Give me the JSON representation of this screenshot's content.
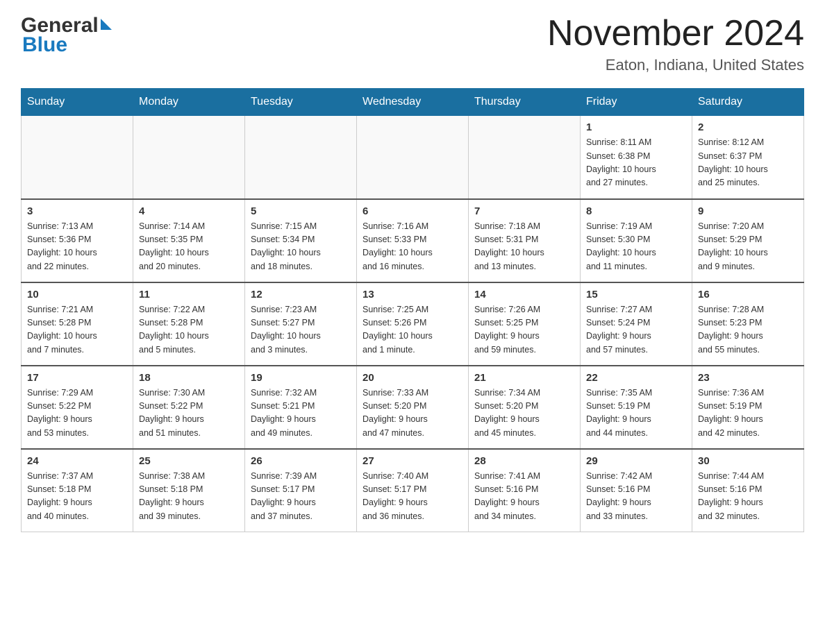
{
  "header": {
    "logo_text1": "General",
    "logo_text2": "Blue",
    "calendar_title": "November 2024",
    "calendar_subtitle": "Eaton, Indiana, United States"
  },
  "weekdays": [
    "Sunday",
    "Monday",
    "Tuesday",
    "Wednesday",
    "Thursday",
    "Friday",
    "Saturday"
  ],
  "weeks": [
    [
      {
        "day": "",
        "info": ""
      },
      {
        "day": "",
        "info": ""
      },
      {
        "day": "",
        "info": ""
      },
      {
        "day": "",
        "info": ""
      },
      {
        "day": "",
        "info": ""
      },
      {
        "day": "1",
        "info": "Sunrise: 8:11 AM\nSunset: 6:38 PM\nDaylight: 10 hours\nand 27 minutes."
      },
      {
        "day": "2",
        "info": "Sunrise: 8:12 AM\nSunset: 6:37 PM\nDaylight: 10 hours\nand 25 minutes."
      }
    ],
    [
      {
        "day": "3",
        "info": "Sunrise: 7:13 AM\nSunset: 5:36 PM\nDaylight: 10 hours\nand 22 minutes."
      },
      {
        "day": "4",
        "info": "Sunrise: 7:14 AM\nSunset: 5:35 PM\nDaylight: 10 hours\nand 20 minutes."
      },
      {
        "day": "5",
        "info": "Sunrise: 7:15 AM\nSunset: 5:34 PM\nDaylight: 10 hours\nand 18 minutes."
      },
      {
        "day": "6",
        "info": "Sunrise: 7:16 AM\nSunset: 5:33 PM\nDaylight: 10 hours\nand 16 minutes."
      },
      {
        "day": "7",
        "info": "Sunrise: 7:18 AM\nSunset: 5:31 PM\nDaylight: 10 hours\nand 13 minutes."
      },
      {
        "day": "8",
        "info": "Sunrise: 7:19 AM\nSunset: 5:30 PM\nDaylight: 10 hours\nand 11 minutes."
      },
      {
        "day": "9",
        "info": "Sunrise: 7:20 AM\nSunset: 5:29 PM\nDaylight: 10 hours\nand 9 minutes."
      }
    ],
    [
      {
        "day": "10",
        "info": "Sunrise: 7:21 AM\nSunset: 5:28 PM\nDaylight: 10 hours\nand 7 minutes."
      },
      {
        "day": "11",
        "info": "Sunrise: 7:22 AM\nSunset: 5:28 PM\nDaylight: 10 hours\nand 5 minutes."
      },
      {
        "day": "12",
        "info": "Sunrise: 7:23 AM\nSunset: 5:27 PM\nDaylight: 10 hours\nand 3 minutes."
      },
      {
        "day": "13",
        "info": "Sunrise: 7:25 AM\nSunset: 5:26 PM\nDaylight: 10 hours\nand 1 minute."
      },
      {
        "day": "14",
        "info": "Sunrise: 7:26 AM\nSunset: 5:25 PM\nDaylight: 9 hours\nand 59 minutes."
      },
      {
        "day": "15",
        "info": "Sunrise: 7:27 AM\nSunset: 5:24 PM\nDaylight: 9 hours\nand 57 minutes."
      },
      {
        "day": "16",
        "info": "Sunrise: 7:28 AM\nSunset: 5:23 PM\nDaylight: 9 hours\nand 55 minutes."
      }
    ],
    [
      {
        "day": "17",
        "info": "Sunrise: 7:29 AM\nSunset: 5:22 PM\nDaylight: 9 hours\nand 53 minutes."
      },
      {
        "day": "18",
        "info": "Sunrise: 7:30 AM\nSunset: 5:22 PM\nDaylight: 9 hours\nand 51 minutes."
      },
      {
        "day": "19",
        "info": "Sunrise: 7:32 AM\nSunset: 5:21 PM\nDaylight: 9 hours\nand 49 minutes."
      },
      {
        "day": "20",
        "info": "Sunrise: 7:33 AM\nSunset: 5:20 PM\nDaylight: 9 hours\nand 47 minutes."
      },
      {
        "day": "21",
        "info": "Sunrise: 7:34 AM\nSunset: 5:20 PM\nDaylight: 9 hours\nand 45 minutes."
      },
      {
        "day": "22",
        "info": "Sunrise: 7:35 AM\nSunset: 5:19 PM\nDaylight: 9 hours\nand 44 minutes."
      },
      {
        "day": "23",
        "info": "Sunrise: 7:36 AM\nSunset: 5:19 PM\nDaylight: 9 hours\nand 42 minutes."
      }
    ],
    [
      {
        "day": "24",
        "info": "Sunrise: 7:37 AM\nSunset: 5:18 PM\nDaylight: 9 hours\nand 40 minutes."
      },
      {
        "day": "25",
        "info": "Sunrise: 7:38 AM\nSunset: 5:18 PM\nDaylight: 9 hours\nand 39 minutes."
      },
      {
        "day": "26",
        "info": "Sunrise: 7:39 AM\nSunset: 5:17 PM\nDaylight: 9 hours\nand 37 minutes."
      },
      {
        "day": "27",
        "info": "Sunrise: 7:40 AM\nSunset: 5:17 PM\nDaylight: 9 hours\nand 36 minutes."
      },
      {
        "day": "28",
        "info": "Sunrise: 7:41 AM\nSunset: 5:16 PM\nDaylight: 9 hours\nand 34 minutes."
      },
      {
        "day": "29",
        "info": "Sunrise: 7:42 AM\nSunset: 5:16 PM\nDaylight: 9 hours\nand 33 minutes."
      },
      {
        "day": "30",
        "info": "Sunrise: 7:44 AM\nSunset: 5:16 PM\nDaylight: 9 hours\nand 32 minutes."
      }
    ]
  ]
}
